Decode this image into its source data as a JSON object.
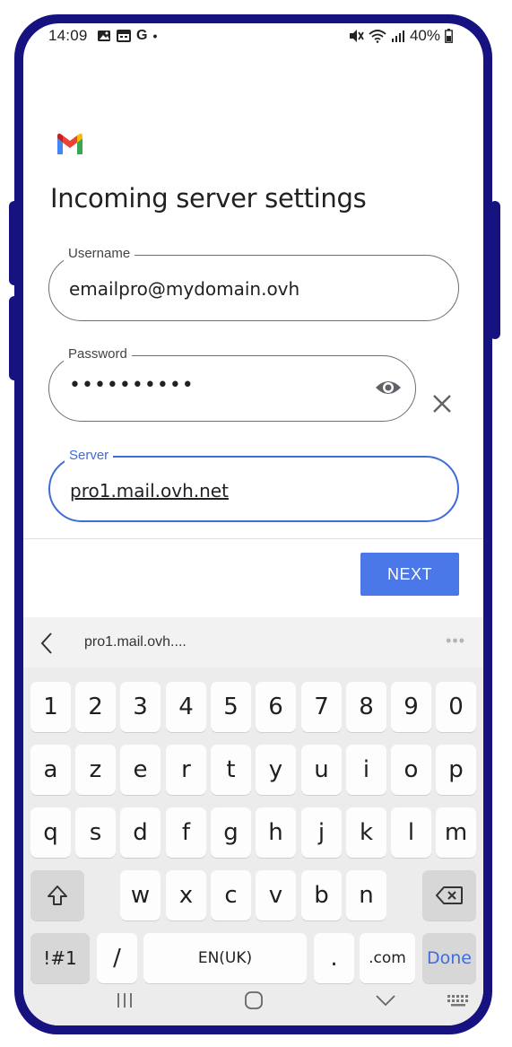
{
  "status_bar": {
    "time": "14:09",
    "battery": "40%"
  },
  "header": {
    "title": "Incoming server settings"
  },
  "fields": {
    "username": {
      "label": "Username",
      "value": "emailpro@mydomain.ovh"
    },
    "password": {
      "label": "Password",
      "value": "••••••••••"
    },
    "server": {
      "label": "Server",
      "value": "pro1.mail.ovh.net"
    }
  },
  "actions": {
    "next_label": "NEXT"
  },
  "keyboard": {
    "suggestion": "pro1.mail.ovh....",
    "more": "•••",
    "row_numbers": [
      "1",
      "2",
      "3",
      "4",
      "5",
      "6",
      "7",
      "8",
      "9",
      "0"
    ],
    "row_1": [
      "a",
      "z",
      "e",
      "r",
      "t",
      "y",
      "u",
      "i",
      "o",
      "p"
    ],
    "row_2": [
      "q",
      "s",
      "d",
      "f",
      "g",
      "h",
      "j",
      "k",
      "l",
      "m"
    ],
    "row_3": [
      "w",
      "x",
      "c",
      "v",
      "b",
      "n"
    ],
    "symbols_label": "!#1",
    "slash_label": "/",
    "space_label": "EN(UK)",
    "dot_label": ".",
    "dotcom_label": ".com",
    "done_label": "Done"
  },
  "colors": {
    "accent": "#3f6cd9",
    "frame": "#16127f",
    "button": "#4a78e8"
  }
}
